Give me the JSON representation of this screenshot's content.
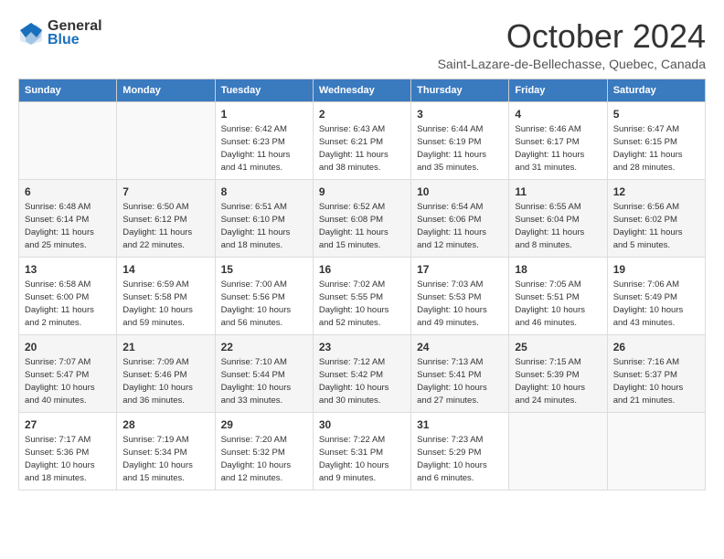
{
  "header": {
    "logo_line1": "General",
    "logo_line2": "Blue",
    "month": "October 2024",
    "location": "Saint-Lazare-de-Bellechasse, Quebec, Canada"
  },
  "weekdays": [
    "Sunday",
    "Monday",
    "Tuesday",
    "Wednesday",
    "Thursday",
    "Friday",
    "Saturday"
  ],
  "weeks": [
    [
      {
        "day": null
      },
      {
        "day": null
      },
      {
        "day": "1",
        "sunrise": "Sunrise: 6:42 AM",
        "sunset": "Sunset: 6:23 PM",
        "daylight": "Daylight: 11 hours and 41 minutes."
      },
      {
        "day": "2",
        "sunrise": "Sunrise: 6:43 AM",
        "sunset": "Sunset: 6:21 PM",
        "daylight": "Daylight: 11 hours and 38 minutes."
      },
      {
        "day": "3",
        "sunrise": "Sunrise: 6:44 AM",
        "sunset": "Sunset: 6:19 PM",
        "daylight": "Daylight: 11 hours and 35 minutes."
      },
      {
        "day": "4",
        "sunrise": "Sunrise: 6:46 AM",
        "sunset": "Sunset: 6:17 PM",
        "daylight": "Daylight: 11 hours and 31 minutes."
      },
      {
        "day": "5",
        "sunrise": "Sunrise: 6:47 AM",
        "sunset": "Sunset: 6:15 PM",
        "daylight": "Daylight: 11 hours and 28 minutes."
      }
    ],
    [
      {
        "day": "6",
        "sunrise": "Sunrise: 6:48 AM",
        "sunset": "Sunset: 6:14 PM",
        "daylight": "Daylight: 11 hours and 25 minutes."
      },
      {
        "day": "7",
        "sunrise": "Sunrise: 6:50 AM",
        "sunset": "Sunset: 6:12 PM",
        "daylight": "Daylight: 11 hours and 22 minutes."
      },
      {
        "day": "8",
        "sunrise": "Sunrise: 6:51 AM",
        "sunset": "Sunset: 6:10 PM",
        "daylight": "Daylight: 11 hours and 18 minutes."
      },
      {
        "day": "9",
        "sunrise": "Sunrise: 6:52 AM",
        "sunset": "Sunset: 6:08 PM",
        "daylight": "Daylight: 11 hours and 15 minutes."
      },
      {
        "day": "10",
        "sunrise": "Sunrise: 6:54 AM",
        "sunset": "Sunset: 6:06 PM",
        "daylight": "Daylight: 11 hours and 12 minutes."
      },
      {
        "day": "11",
        "sunrise": "Sunrise: 6:55 AM",
        "sunset": "Sunset: 6:04 PM",
        "daylight": "Daylight: 11 hours and 8 minutes."
      },
      {
        "day": "12",
        "sunrise": "Sunrise: 6:56 AM",
        "sunset": "Sunset: 6:02 PM",
        "daylight": "Daylight: 11 hours and 5 minutes."
      }
    ],
    [
      {
        "day": "13",
        "sunrise": "Sunrise: 6:58 AM",
        "sunset": "Sunset: 6:00 PM",
        "daylight": "Daylight: 11 hours and 2 minutes."
      },
      {
        "day": "14",
        "sunrise": "Sunrise: 6:59 AM",
        "sunset": "Sunset: 5:58 PM",
        "daylight": "Daylight: 10 hours and 59 minutes."
      },
      {
        "day": "15",
        "sunrise": "Sunrise: 7:00 AM",
        "sunset": "Sunset: 5:56 PM",
        "daylight": "Daylight: 10 hours and 56 minutes."
      },
      {
        "day": "16",
        "sunrise": "Sunrise: 7:02 AM",
        "sunset": "Sunset: 5:55 PM",
        "daylight": "Daylight: 10 hours and 52 minutes."
      },
      {
        "day": "17",
        "sunrise": "Sunrise: 7:03 AM",
        "sunset": "Sunset: 5:53 PM",
        "daylight": "Daylight: 10 hours and 49 minutes."
      },
      {
        "day": "18",
        "sunrise": "Sunrise: 7:05 AM",
        "sunset": "Sunset: 5:51 PM",
        "daylight": "Daylight: 10 hours and 46 minutes."
      },
      {
        "day": "19",
        "sunrise": "Sunrise: 7:06 AM",
        "sunset": "Sunset: 5:49 PM",
        "daylight": "Daylight: 10 hours and 43 minutes."
      }
    ],
    [
      {
        "day": "20",
        "sunrise": "Sunrise: 7:07 AM",
        "sunset": "Sunset: 5:47 PM",
        "daylight": "Daylight: 10 hours and 40 minutes."
      },
      {
        "day": "21",
        "sunrise": "Sunrise: 7:09 AM",
        "sunset": "Sunset: 5:46 PM",
        "daylight": "Daylight: 10 hours and 36 minutes."
      },
      {
        "day": "22",
        "sunrise": "Sunrise: 7:10 AM",
        "sunset": "Sunset: 5:44 PM",
        "daylight": "Daylight: 10 hours and 33 minutes."
      },
      {
        "day": "23",
        "sunrise": "Sunrise: 7:12 AM",
        "sunset": "Sunset: 5:42 PM",
        "daylight": "Daylight: 10 hours and 30 minutes."
      },
      {
        "day": "24",
        "sunrise": "Sunrise: 7:13 AM",
        "sunset": "Sunset: 5:41 PM",
        "daylight": "Daylight: 10 hours and 27 minutes."
      },
      {
        "day": "25",
        "sunrise": "Sunrise: 7:15 AM",
        "sunset": "Sunset: 5:39 PM",
        "daylight": "Daylight: 10 hours and 24 minutes."
      },
      {
        "day": "26",
        "sunrise": "Sunrise: 7:16 AM",
        "sunset": "Sunset: 5:37 PM",
        "daylight": "Daylight: 10 hours and 21 minutes."
      }
    ],
    [
      {
        "day": "27",
        "sunrise": "Sunrise: 7:17 AM",
        "sunset": "Sunset: 5:36 PM",
        "daylight": "Daylight: 10 hours and 18 minutes."
      },
      {
        "day": "28",
        "sunrise": "Sunrise: 7:19 AM",
        "sunset": "Sunset: 5:34 PM",
        "daylight": "Daylight: 10 hours and 15 minutes."
      },
      {
        "day": "29",
        "sunrise": "Sunrise: 7:20 AM",
        "sunset": "Sunset: 5:32 PM",
        "daylight": "Daylight: 10 hours and 12 minutes."
      },
      {
        "day": "30",
        "sunrise": "Sunrise: 7:22 AM",
        "sunset": "Sunset: 5:31 PM",
        "daylight": "Daylight: 10 hours and 9 minutes."
      },
      {
        "day": "31",
        "sunrise": "Sunrise: 7:23 AM",
        "sunset": "Sunset: 5:29 PM",
        "daylight": "Daylight: 10 hours and 6 minutes."
      },
      {
        "day": null
      },
      {
        "day": null
      }
    ]
  ]
}
